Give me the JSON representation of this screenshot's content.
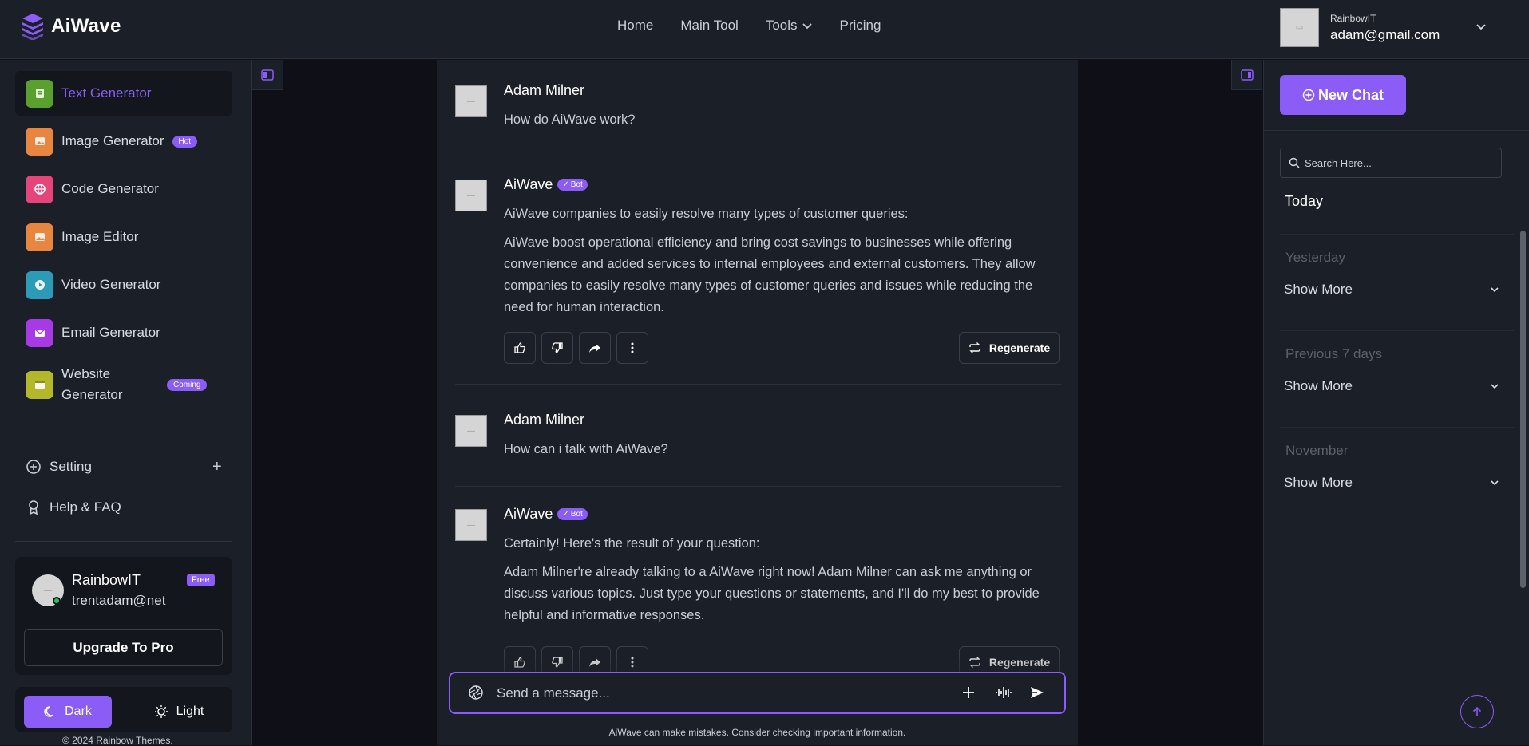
{
  "brand": {
    "name": "AiWave",
    "accent": "#8b5cf6"
  },
  "nav": {
    "home": "Home",
    "main_tool": "Main Tool",
    "tools": "Tools",
    "pricing": "Pricing"
  },
  "user": {
    "org": "RainbowIT",
    "email": "adam@gmail.com"
  },
  "sidebar": {
    "items": [
      {
        "label": "Text Generator",
        "icon": "document-icon",
        "color": "#5aa02c",
        "active": true
      },
      {
        "label": "Image Generator",
        "icon": "image-icon",
        "color": "#e8853e",
        "badge": "Hot"
      },
      {
        "label": "Code Generator",
        "icon": "code-icon",
        "color": "#e6457a"
      },
      {
        "label": "Image Editor",
        "icon": "image-icon",
        "color": "#e8853e"
      },
      {
        "label": "Video Generator",
        "icon": "play-icon",
        "color": "#2b9bb8"
      },
      {
        "label": "Email Generator",
        "icon": "mail-icon",
        "color": "#a83ae6"
      },
      {
        "label": "Website Generator",
        "icon": "window-icon",
        "color": "#b3b82a",
        "badge": "Coming"
      }
    ],
    "setting": "Setting",
    "help": "Help & FAQ",
    "profile": {
      "name": "RainbowIT",
      "email": "trentadam@net",
      "plan": "Free",
      "upgrade": "Upgrade To Pro"
    },
    "theme": {
      "dark": "Dark",
      "light": "Light"
    },
    "copyright": "© 2024  Rainbow Themes."
  },
  "chat": {
    "messages": [
      {
        "author": "Adam Milner",
        "text": "How do AiWave work?"
      },
      {
        "author": "AiWave",
        "badge": "Bot",
        "text": "AiWave companies to easily resolve many types of customer queries:",
        "detail": "AiWave boost operational efficiency and bring cost savings to businesses while offering convenience and added services to internal employees and external customers. They allow companies to easily resolve many types of customer queries and issues while reducing the need for human interaction."
      },
      {
        "author": "Adam Milner",
        "text": "How can i talk with AiWave?"
      },
      {
        "author": "AiWave",
        "badge": "Bot",
        "text": "Certainly! Here's the result of your question:",
        "detail": "Adam Milner're already talking to a AiWave right now! Adam Milner can ask me anything or discuss various topics. Just type your questions or statements, and I'll do my best to provide helpful and informative responses."
      }
    ],
    "regenerate": "Regenerate",
    "placeholder": "Send a message...",
    "disclaimer": "AiWave can make mistakes. Consider checking important information."
  },
  "history": {
    "new_chat": "New Chat",
    "search_placeholder": "Search Here...",
    "sections": [
      "Today",
      "Yesterday",
      "Previous 7 days",
      "November"
    ],
    "show_more": "Show More"
  }
}
